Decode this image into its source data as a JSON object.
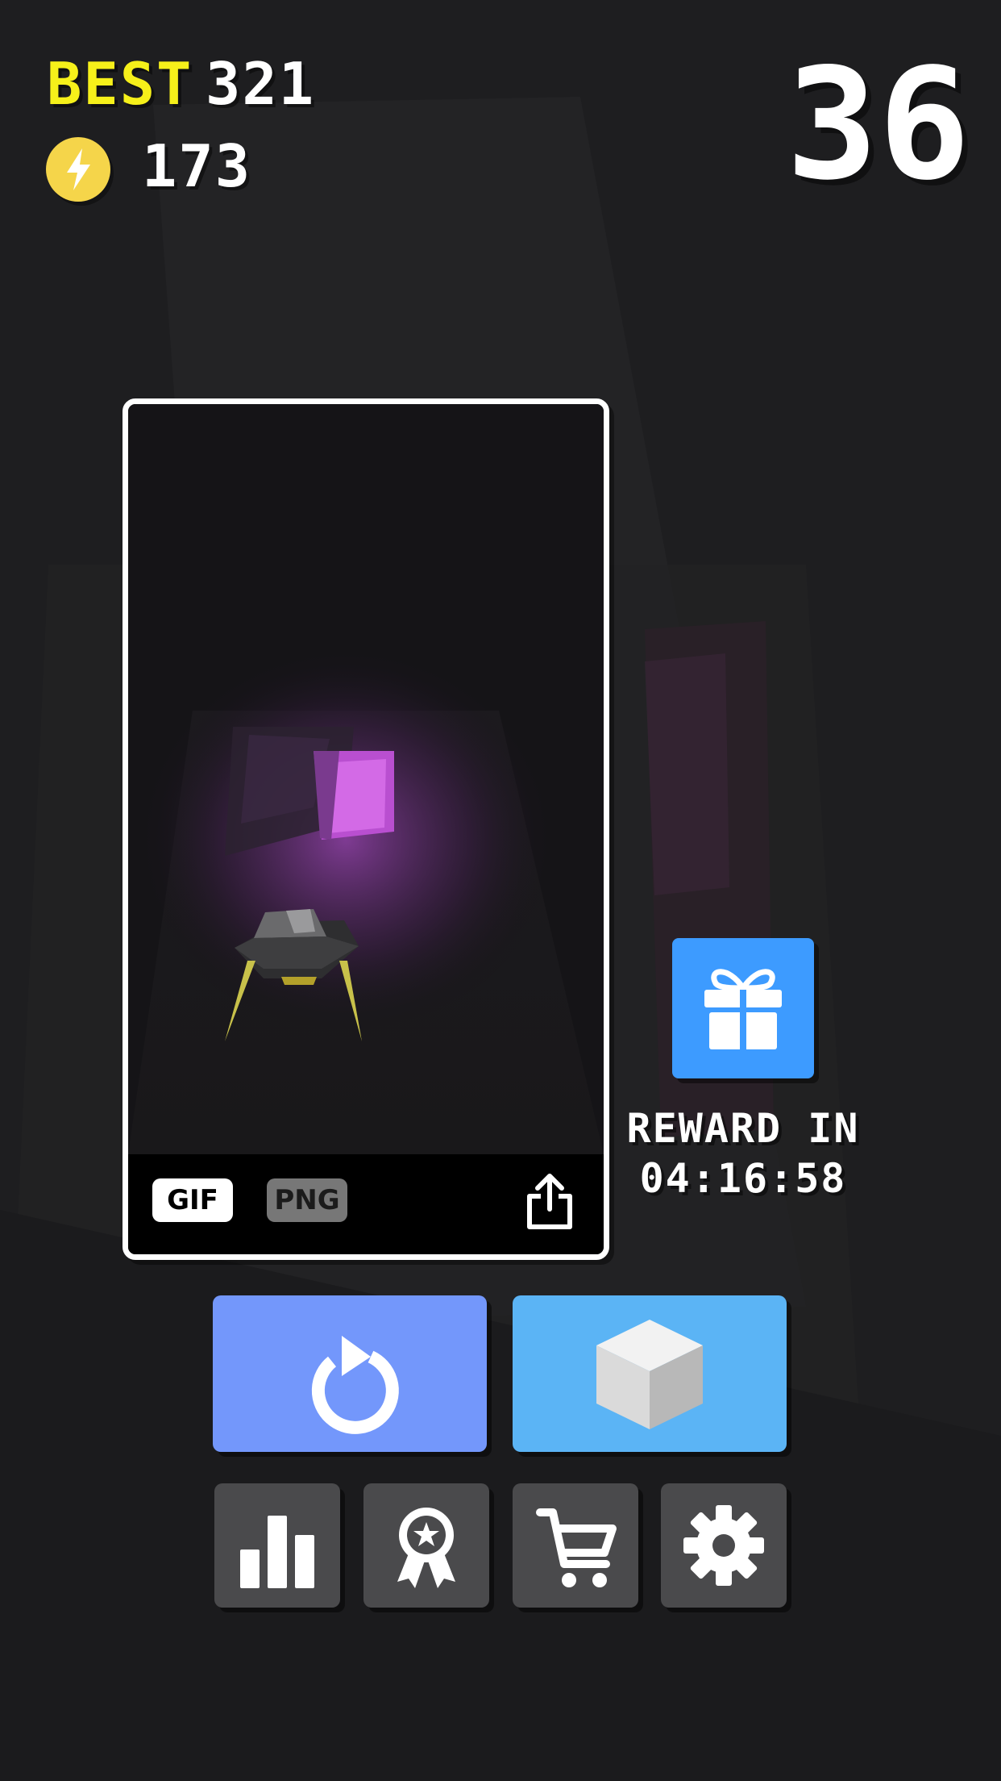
{
  "hud": {
    "best_label": "BEST",
    "best_value": "321",
    "coins": "173",
    "coin_icon": "lightning-coin-icon",
    "current_score": "36"
  },
  "replay_card": {
    "format_gif": "GIF",
    "format_png": "PNG",
    "share_icon": "share-icon"
  },
  "reward": {
    "gift_icon": "gift-icon",
    "label": "REWARD IN",
    "countdown": "04:16:58"
  },
  "buttons": {
    "restart_icon": "restart-icon",
    "skins_icon": "cube-icon",
    "leaderboard_icon": "leaderboard-icon",
    "achievements_icon": "ribbon-icon",
    "shop_icon": "cart-icon",
    "settings_icon": "gear-icon"
  },
  "colors": {
    "best_label": "#f6f01a",
    "coin": "#f5d54a",
    "gift_button": "#3d9bff",
    "restart_button": "#7397fb",
    "skins_button": "#5bb4f5",
    "small_button": "#4a4a4c",
    "tunnel_glow": "#d36ae6"
  }
}
